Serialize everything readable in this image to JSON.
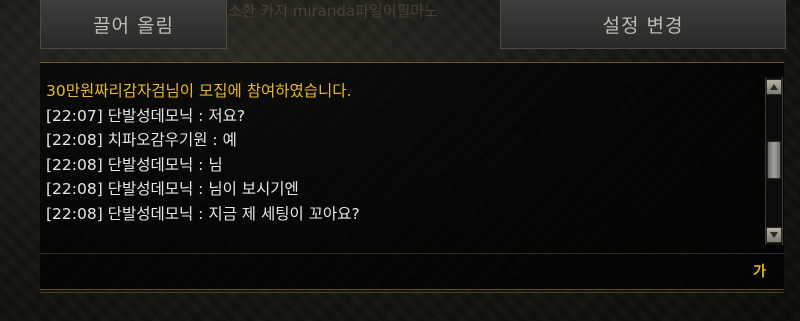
{
  "tabs": {
    "left_label": "끌어 올림",
    "right_label": "설정 변경"
  },
  "background_title": "소환 카지 miranda파일이필마노",
  "chat": {
    "messages": [
      "30만원짜리감자검님이 모집에 참여하였습니다.",
      "[22:07] 단발성데모닉 : 저요?",
      "[22:08] 치파오감우기원 : 예",
      "[22:08] 단발성데모닉 : 님",
      "[22:08] 단발성데모닉 : 님이 보시기엔",
      "[22:08] 단발성데모닉 : 지금 제 세팅이 꼬아요?"
    ],
    "system_color": "#e8b830",
    "text_color": "#e6e6e6"
  },
  "input": {
    "ime_indicator": "가"
  },
  "scrollbar": {
    "up_icon": "triangle-up-icon",
    "down_icon": "triangle-down-icon"
  }
}
